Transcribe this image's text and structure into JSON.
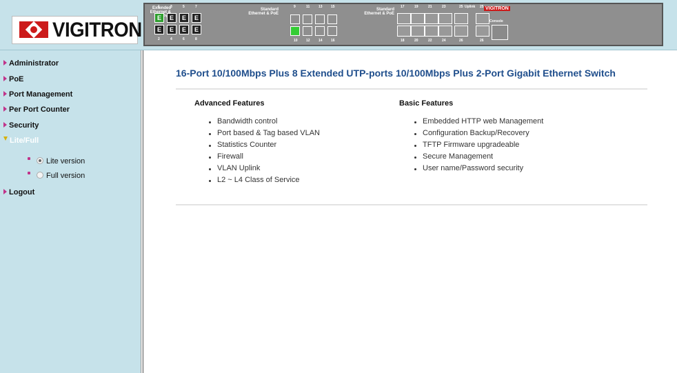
{
  "header": {
    "logo_text": "VIGITRON",
    "panel": {
      "extended_label": "Extended Ethernet & PoE",
      "standard_label_1": "Standard Ethernet & PoE",
      "standard_label_2": "Standard Ethernet & PoE",
      "uplink_label": "Uplink",
      "console_label": "Console",
      "mini_logo": "VIGITRON",
      "ext_top_nums": [
        "1",
        "3",
        "5",
        "7"
      ],
      "ext_bottom_nums": [
        "2",
        "4",
        "6",
        "8"
      ],
      "std1_top_nums": [
        "9",
        "11",
        "13",
        "15"
      ],
      "std1_bottom_nums": [
        "10",
        "12",
        "14",
        "16"
      ],
      "std2_top_nums": [
        "17",
        "19",
        "21",
        "23"
      ],
      "std2_bottom_nums": [
        "18",
        "20",
        "22",
        "24"
      ],
      "uplink_top_nums": [
        "25",
        "25"
      ],
      "uplink_bottom_nums": [
        "26",
        "26"
      ],
      "ext_port_glyph": "E",
      "active_ports": [
        "1",
        "10"
      ]
    }
  },
  "sidebar": {
    "items": [
      {
        "label": "Administrator"
      },
      {
        "label": "PoE"
      },
      {
        "label": "Port Management"
      },
      {
        "label": "Per Port Counter"
      },
      {
        "label": "Security"
      },
      {
        "label": "Lite/Full"
      },
      {
        "label": "Logout"
      }
    ],
    "version_options": [
      {
        "label": "Lite version",
        "checked": true
      },
      {
        "label": "Full version",
        "checked": false
      }
    ]
  },
  "main": {
    "title": "16-Port 10/100Mbps Plus 8 Extended UTP-ports 10/100Mbps Plus 2-Port Gigabit Ethernet Switch",
    "advanced": {
      "heading": "Advanced Features",
      "items": [
        "Bandwidth control",
        "Port based & Tag based VLAN",
        "Statistics Counter",
        "Firewall",
        "VLAN Uplink",
        "L2 ~ L4 Class of Service"
      ]
    },
    "basic": {
      "heading": "Basic Features",
      "items": [
        "Embedded HTTP web Management",
        "Configuration Backup/Recovery",
        "TFTP Firmware upgradeable",
        "Secure Management",
        "User name/Password security"
      ]
    }
  },
  "colors": {
    "sidebar_bg": "#c6e2ea",
    "title_blue": "#1f4e8c",
    "arrow_pink": "#c0338a",
    "logo_red": "#cc1a1a",
    "port_active_green": "#33cc33"
  }
}
